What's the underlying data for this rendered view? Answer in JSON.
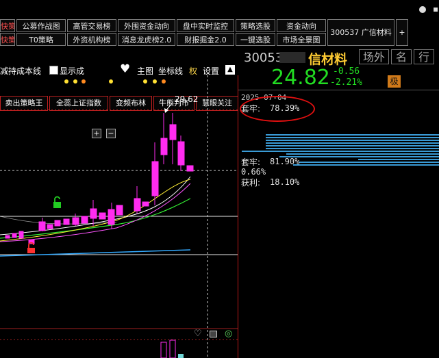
{
  "nav": {
    "row1": [
      "快策",
      "公募作战图",
      "高管交易榜",
      "外围资金动向",
      "盘中实时监控",
      "策略选股",
      "资金动向"
    ],
    "row2": [
      "快策",
      "T0策略",
      "外资机构榜",
      "消息龙虎榜2.0",
      "财报掘金2.0",
      "一键选股",
      "市场全景图"
    ],
    "stock_tab": "300537 广信材料",
    "plus": "+"
  },
  "toolbar": [
    "卖出策略王",
    "全蕊上证指数",
    "变频布林",
    "牛熊判市",
    "慧眼关注"
  ],
  "chart_header": {
    "cost_line": "减持成本线",
    "show_cost": "显示成",
    "main_chart": "主图",
    "coord_line": "坐标线",
    "rights": "权",
    "settings": "设置"
  },
  "chart": {
    "high_label": "29.62",
    "colors": {
      "up": "#ff2cf0",
      "ma1": "#ffffff",
      "ma2": "#ffee33",
      "ma3": "#ff55ff",
      "ma4": "#33ee33",
      "ma5": "#33aaff",
      "lock": "#22cc22"
    }
  },
  "quote": {
    "code": "30053",
    "name": "信材料",
    "tabs": [
      "场外",
      "名",
      "行"
    ],
    "price": "24.82",
    "change": "-0.56",
    "change_pct": "-2.21%",
    "badge": "极"
  },
  "chip": {
    "date": "2025-07-04",
    "trapped1_label": "套牢:",
    "trapped1_value": "78.39%",
    "trapped2_label": "套牢:",
    "trapped2_value": "81.90%",
    "small_value": "0.66%",
    "profit_label": "获利:",
    "profit_value": "18.10%"
  }
}
